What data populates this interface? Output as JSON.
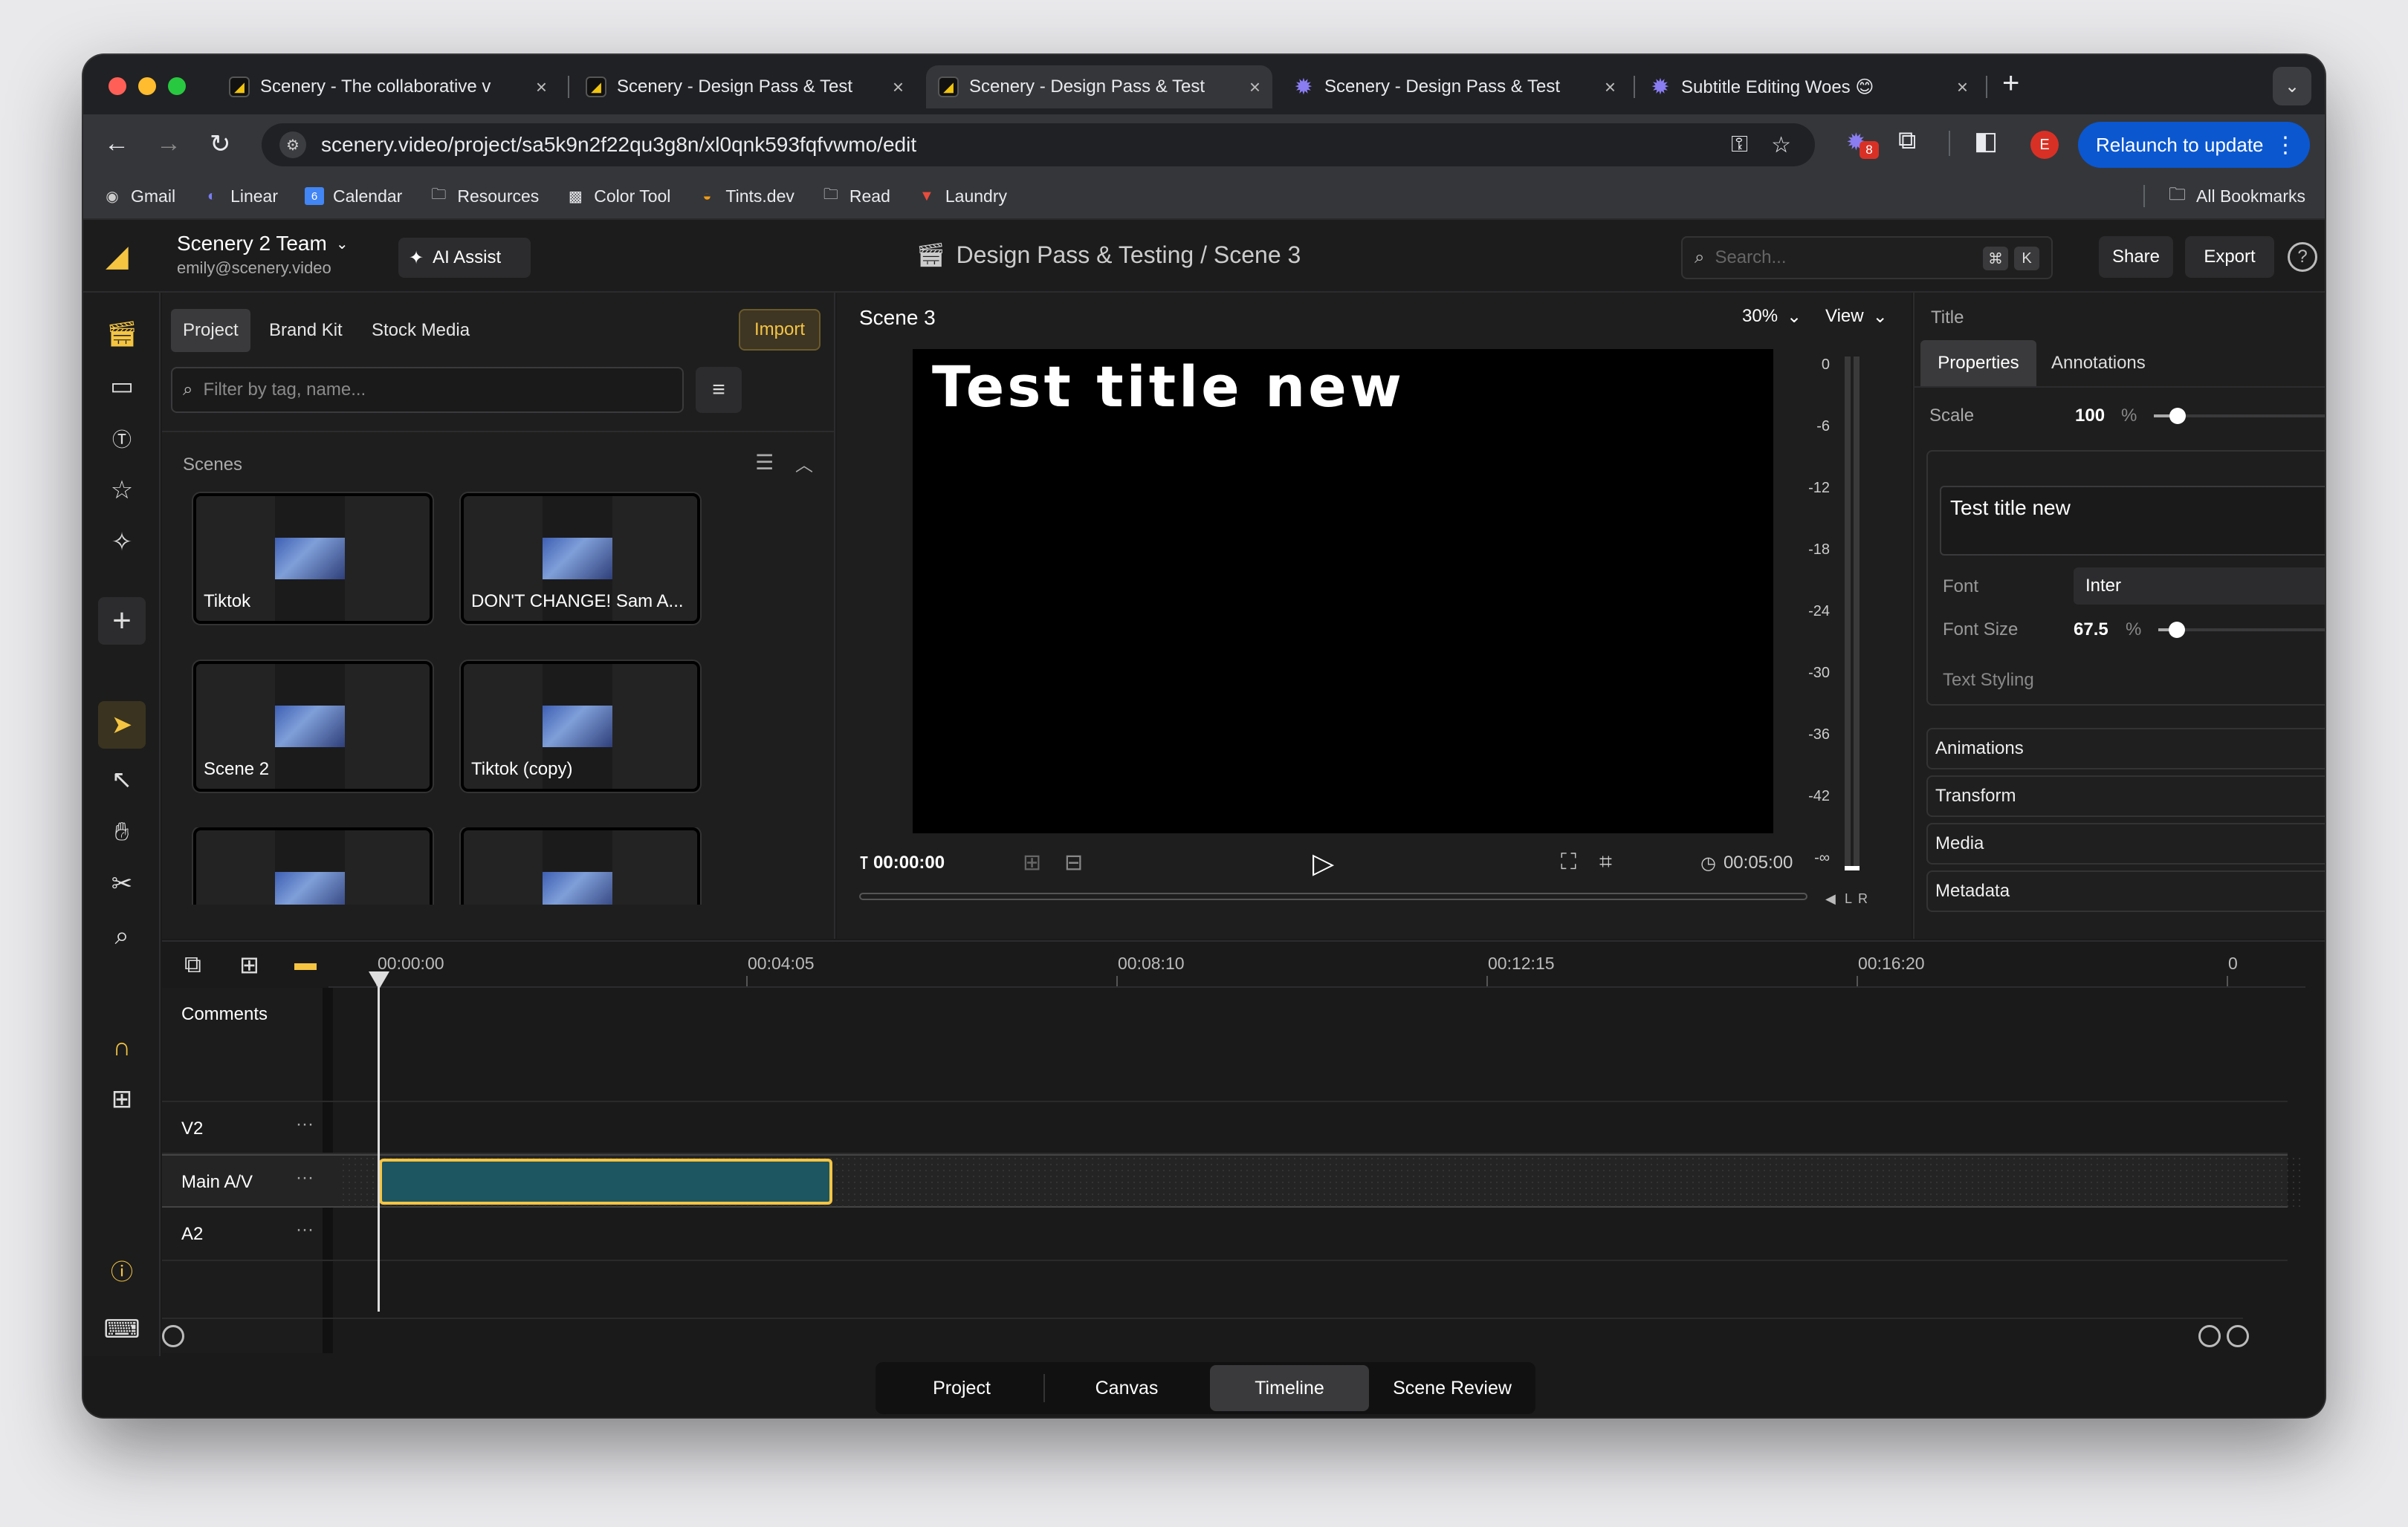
{
  "browser": {
    "tabs": [
      {
        "title": "Scenery - The collaborative v",
        "icon": "scenery-icon"
      },
      {
        "title": "Scenery - Design Pass & Test",
        "icon": "scenery-icon"
      },
      {
        "title": "Scenery - Design Pass & Test",
        "icon": "scenery-icon",
        "active": true
      },
      {
        "title": "Scenery - Design Pass & Test",
        "icon": "star-burst-icon"
      },
      {
        "title": "Subtitle Editing Woes 😊",
        "icon": "star-burst-icon"
      }
    ],
    "new_tab": "+",
    "url": "scenery.video/project/sa5k9n2f22qu3g8n/xl0qnk593fqfvwmo/edit",
    "extension_badge": "8",
    "profile_initial": "E",
    "relaunch_label": "Relaunch to update",
    "bookmarks": [
      {
        "label": "Gmail",
        "icon": "gmail-icon"
      },
      {
        "label": "Linear",
        "icon": "linear-icon"
      },
      {
        "label": "Calendar",
        "icon": "calendar-icon"
      },
      {
        "label": "Resources",
        "icon": "folder-icon"
      },
      {
        "label": "Color Tool",
        "icon": "color-tool-icon"
      },
      {
        "label": "Tints.dev",
        "icon": "palette-icon"
      },
      {
        "label": "Read",
        "icon": "folder-icon"
      },
      {
        "label": "Laundry",
        "icon": "shirt-icon"
      }
    ],
    "all_bookmarks": "All Bookmarks",
    "calendar_day": "6"
  },
  "header": {
    "team": "Scenery 2 Team",
    "email": "emily@scenery.video",
    "ai_assist": "AI Assist",
    "breadcrumb": "Design Pass & Testing / Scene 3",
    "search_placeholder": "Search...",
    "kbd_cmd": "⌘",
    "kbd_k": "K",
    "share": "Share",
    "export": "Export",
    "help": "?"
  },
  "project_panel": {
    "tabs": [
      "Project",
      "Brand Kit",
      "Stock Media"
    ],
    "import": "Import",
    "filter_placeholder": "Filter by tag, name...",
    "scenes_label": "Scenes",
    "scenes": [
      "Tiktok",
      "DON'T CHANGE! Sam A...",
      "Scene 2",
      "Tiktok (copy)",
      "",
      ""
    ]
  },
  "viewer": {
    "scene_name": "Scene 3",
    "zoom": "30%",
    "view": "View",
    "title_text": "Test title new",
    "current_time": "00:00:00",
    "duration": "00:05:00",
    "meter_labels": [
      "0",
      "-6",
      "-12",
      "-18",
      "-24",
      "-30",
      "-36",
      "-42",
      "-∞"
    ],
    "meter_l": "L",
    "meter_r": "R"
  },
  "properties": {
    "section": "Title",
    "tabs": [
      "Properties",
      "Annotations"
    ],
    "scale_label": "Scale",
    "scale_value": "100",
    "scale_unit": "%",
    "scale_level": 0.12,
    "text_value": "Test title new",
    "font_label": "Font",
    "font_value": "Inter",
    "font_size_label": "Font Size",
    "font_size_value": "67.5",
    "font_size_unit": "%",
    "font_size_level": 0.1,
    "text_styling": "Text Styling",
    "accordions": [
      "Animations",
      "Transform",
      "Media",
      "Metadata"
    ]
  },
  "timeline": {
    "ticks": [
      "00:00:00",
      "00:04:05",
      "00:08:10",
      "00:12:15",
      "00:16:20",
      "0"
    ],
    "tracks": [
      "Comments",
      "V2",
      "Main A/V",
      "A2"
    ],
    "more": "···"
  },
  "bottom_tabs": [
    "Project",
    "Canvas",
    "Timeline",
    "Scene Review"
  ],
  "active_bottom_tab": "Timeline",
  "colors": {
    "accent": "#f5c542",
    "clip": "#1d5560",
    "relaunch": "#0b57d0"
  }
}
